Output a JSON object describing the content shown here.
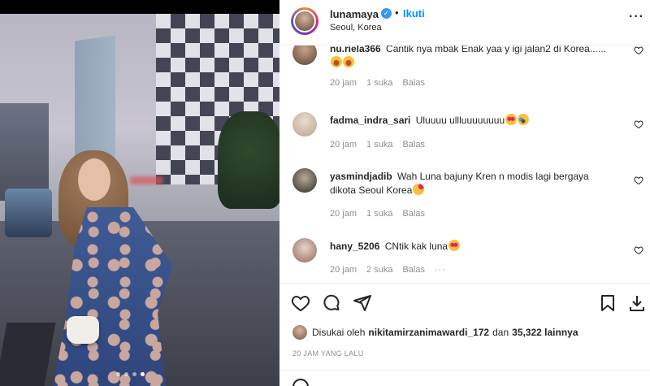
{
  "post": {
    "username": "lunamaya",
    "follow_label": "Ikuti",
    "location": "Seoul, Korea",
    "carousel": {
      "count": 4,
      "active_index": 3
    }
  },
  "comments": [
    {
      "username": "nu.riela366",
      "text": "Cantik nya mbak Enak yaa y igi jalan2 di Korea......",
      "emojis": [
        "grin",
        "grin"
      ],
      "time": "20 jam",
      "likes": "1 suka",
      "reply": "Balas"
    },
    {
      "username": "fadma_indra_sari",
      "text": "Uluuuu ullluuuuuuuu",
      "emojis": [
        "heart-eyes",
        "cry"
      ],
      "time": "20 jam",
      "likes": "1 suka",
      "reply": "Balas"
    },
    {
      "username": "yasmindjadib",
      "text": "Wah Luna bajuny Kren n modis lagi bergaya dikota Seoul Korea",
      "emojis": [
        "love"
      ],
      "time": "20 jam",
      "likes": "1 suka",
      "reply": "Balas"
    },
    {
      "username": "hany_5206",
      "text": "CNtik kak luna",
      "emojis": [
        "heart-eyes"
      ],
      "time": "20 jam",
      "likes": "2 suka",
      "reply": "Balas"
    }
  ],
  "likes": {
    "prefix": "Disukai oleh",
    "user": "nikitamirzanimawardi_172",
    "joiner": "dan",
    "others": "35,322 lainnya"
  },
  "timestamp": "20 JAM YANG LALU",
  "icons": [
    "heart-icon",
    "comment-icon",
    "share-icon",
    "bookmark-icon",
    "download-icon",
    "more-icon",
    "verified-icon",
    "emoji-icon"
  ],
  "colors": {
    "link": "#0095f6",
    "verified": "#3897f0",
    "muted": "#8e8e8e"
  }
}
